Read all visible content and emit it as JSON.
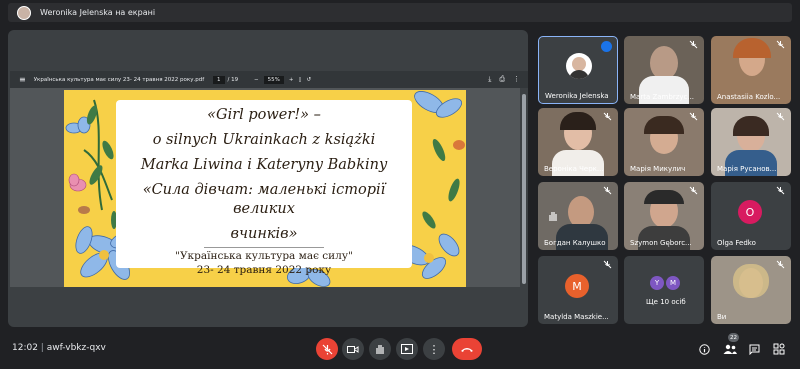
{
  "presenting": {
    "label": "Weronika Jelenska на екрані"
  },
  "pdf": {
    "title": "Українська культура має силу 23- 24 травня 2022 року.pdf",
    "page_current": "1",
    "page_total": "/ 19",
    "zoom": "55%"
  },
  "slide": {
    "line1": "«Girl power!» –",
    "line2": "o silnych Ukrainkach z książki",
    "line3": "Marka Liwina i Kateryny Babkiny",
    "line4": "«Сила дівчат: маленькі історії великих",
    "line5": "вчинків»",
    "sub1": "\"Українська культура має силу\"",
    "sub2": "23- 24 травня 2022 року"
  },
  "participants": [
    {
      "name": "Weronika Jelenska"
    },
    {
      "name": "Marta Zambrzyc..."
    },
    {
      "name": "Anastasiia Kozlo..."
    },
    {
      "name": "Вероніка Черк..."
    },
    {
      "name": "Марія Микулич"
    },
    {
      "name": "Марія Русанов..."
    },
    {
      "name": "Богдан Калушко"
    },
    {
      "name": "Szymon Gęborc..."
    },
    {
      "name": "Olga Fedko",
      "initial": "O"
    },
    {
      "name": "Matylda Maszkie...",
      "initial": "M"
    },
    {
      "name": "Ще 10 осіб",
      "initials": [
        "Y",
        "M"
      ]
    },
    {
      "name": "Ви"
    }
  ],
  "meeting": {
    "time": "12:02",
    "code": "awf-vbkz-qxv"
  },
  "badge_count": "22",
  "colors": {
    "accent": "#8ab4f8",
    "end_call": "#ea4335",
    "mute": "#ea4335"
  }
}
